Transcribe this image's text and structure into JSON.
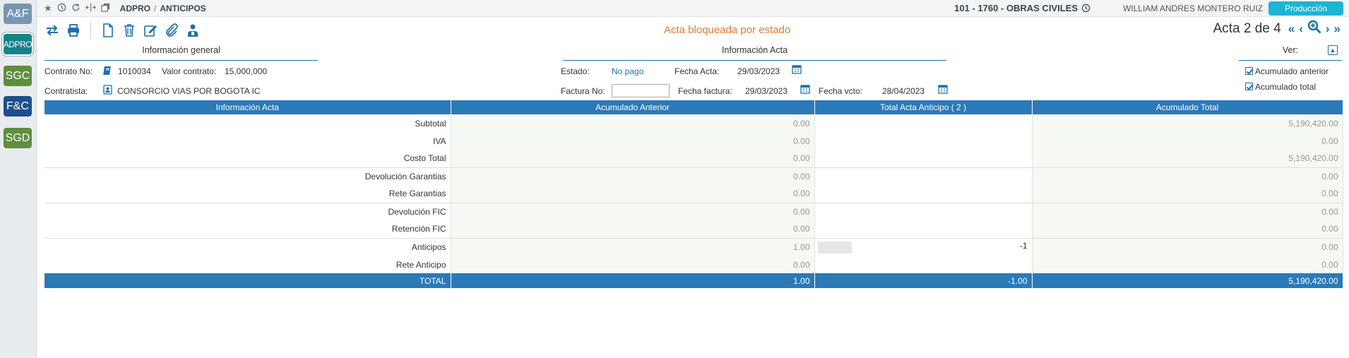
{
  "rail": {
    "apps": [
      {
        "label": "A&F",
        "color": "#7896b2"
      },
      {
        "label": "ADPRO",
        "color": "#158289"
      },
      {
        "label": "SGC",
        "color": "#5e8e3e"
      },
      {
        "label": "F&C",
        "color": "#1d4f8a"
      },
      {
        "label": "SGD",
        "color": "#5e8e3e"
      }
    ]
  },
  "topbar": {
    "breadcrumb": [
      "ADPRO",
      "ANTICIPOS"
    ],
    "project": "101 - 1760 - OBRAS CIVILES",
    "user": "WILLIAM ANDRES MONTERO RUIZ",
    "environment": "Producción"
  },
  "toolbar": {
    "status_message": "Acta bloqueada por estado",
    "acta_label": "Acta 2 de 4"
  },
  "sections": {
    "general": "Información general",
    "acta": "Información Acta",
    "ver": "Ver:"
  },
  "general": {
    "contrato_label": "Contrato No:",
    "contrato_value": "1010034",
    "valor_label": "Valor contrato:",
    "valor_value": "15,000,000",
    "contratista_label": "Contratista:",
    "contratista_value": "CONSORCIO VIAS POR BOGOTA IC"
  },
  "acta": {
    "estado_label": "Estado:",
    "estado_value": "No pago",
    "fecha_acta_label": "Fecha Acta:",
    "fecha_acta_value": "29/03/2023",
    "factura_label": "Factura No:",
    "factura_value": "",
    "fecha_factura_label": "Fecha factura:",
    "fecha_factura_value": "29/03/2023",
    "fecha_vcto_label": "Fecha vcto:",
    "fecha_vcto_value": "28/04/2023"
  },
  "ver": {
    "acumulado_anterior": "Acumulado anterior",
    "acumulado_total": "Acumulado total"
  },
  "table": {
    "headers": [
      "Información Acta",
      "Acumulado Anterior",
      "Total Acta Anticipo ( 2 )",
      "Acumulado Total"
    ],
    "rows": [
      {
        "label": "Subtotal",
        "prev": "0.00",
        "cur": "",
        "total": "5,190,420.00"
      },
      {
        "label": "IVA",
        "prev": "0.00",
        "cur": "",
        "total": "0.00"
      },
      {
        "label": "Costo Total",
        "prev": "0.00",
        "cur": "",
        "total": "5,190,420.00"
      },
      {
        "label": "Devolución Garantias",
        "prev": "0.00",
        "cur": "",
        "total": "0.00"
      },
      {
        "label": "Rete Garantias",
        "prev": "0.00",
        "cur": "",
        "total": "0.00"
      },
      {
        "label": "Devolución FIC",
        "prev": "0.00",
        "cur": "",
        "total": "0.00"
      },
      {
        "label": "Retención FIC",
        "prev": "0.00",
        "cur": "",
        "total": "0.00"
      },
      {
        "label": "Anticipos",
        "prev": "1.00",
        "cur": "-1",
        "total": "0.00"
      },
      {
        "label": "Rete Anticipo",
        "prev": "0.00",
        "cur": "",
        "total": "0.00"
      }
    ],
    "total": {
      "label": "TOTAL",
      "prev": "1.00",
      "cur": "-1.00",
      "total": "5,190,420.00"
    }
  }
}
